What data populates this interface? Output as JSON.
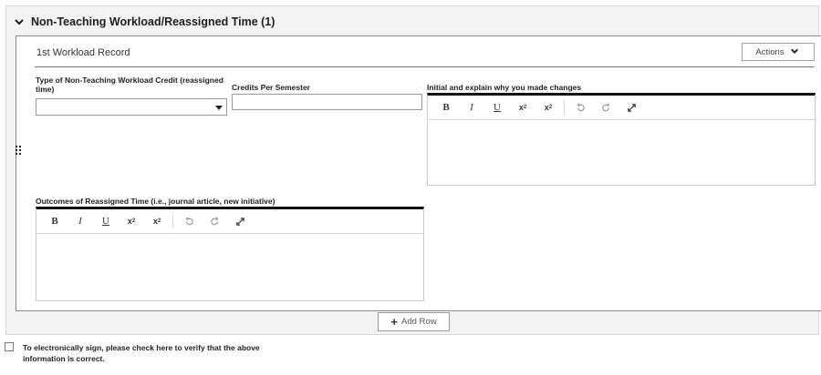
{
  "section": {
    "title": "Non-Teaching Workload/Reassigned Time (1)"
  },
  "record": {
    "title": "1st Workload Record",
    "actions_label": "Actions",
    "fields": {
      "credit_type_label": "Type of Non-Teaching Workload Credit (reassigned time)",
      "credit_type_value": "",
      "credits_label": "Credits Per Semester",
      "credits_value": "",
      "explain_label": "Initial and explain why you made changes",
      "outcomes_label": "Outcomes of Reassigned Time (i.e., journal article, new initiative)"
    },
    "toolbar": {
      "bold": "B",
      "italic": "I",
      "underline": "U",
      "superscript": "x",
      "subscript": "x"
    }
  },
  "add_row_label": "Add Row",
  "signature": {
    "label": "To electronically sign, please check here to verify that the above information is correct.",
    "checked": false
  },
  "icons": {
    "collapse": "chevron-down-icon",
    "actions": "chevron-down-icon",
    "undo": "undo-icon",
    "redo": "redo-icon",
    "fullscreen": "expand-icon",
    "drag": "drag-handle-icon",
    "add": "plus-icon"
  }
}
